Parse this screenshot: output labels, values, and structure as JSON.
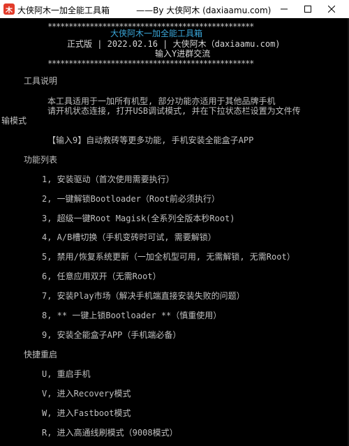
{
  "window": {
    "title": "大侠阿木一加全能工具箱          ——By 大侠阿木 (daxiaamu.com)",
    "icon_char": "木",
    "minimize_icon": "minimize-icon",
    "maximize_icon": "maximize-icon",
    "close_icon": "close-icon"
  },
  "banner": {
    "stars": "*************************************************",
    "name": "大侠阿木一加全能工具箱",
    "info": "正式版 | 2022.02.16 | 大侠阿木（daxiaamu.com)",
    "join": "输入Y进群交流"
  },
  "intro": {
    "heading": "工具说明",
    "line1": "本工具适用于一加所有机型, 部分功能亦适用于其他品牌手机",
    "line2": "请开机状态连接, 打开USB调试模式, 并在下拉状态栏设置为文件传",
    "line3": "输模式",
    "tip": "【输入9】自动救砖等更多功能, 手机安装全能盒子APP"
  },
  "functions": {
    "heading": "功能列表",
    "items": [
      "1, 安装驱动（首次使用需要执行）",
      "2, 一键解锁Bootloader（Root前必须执行）",
      "3, 超级一键Root Magisk(全系列全版本秒Root)",
      "4, A/B槽切换（手机变砖时可试, 需要解锁）",
      "5, 禁用/恢复系统更新（一加全机型可用, 无需解锁, 无需Root）",
      "6, 任意应用双开（无需Root）",
      "7, 安装Play市场（解决手机端直接安装失败的问题）",
      "8, ** 一键上锁Bootloader **（慎重使用）",
      "9, 安装全能盒子APP（手机端必备）"
    ]
  },
  "reboot": {
    "heading": "快捷重启",
    "items": [
      "U, 重启手机",
      "V, 进入Recovery模式",
      "W, 进入Fastboot模式",
      "R, 进入高通线刷模式（9008模式）"
    ]
  }
}
